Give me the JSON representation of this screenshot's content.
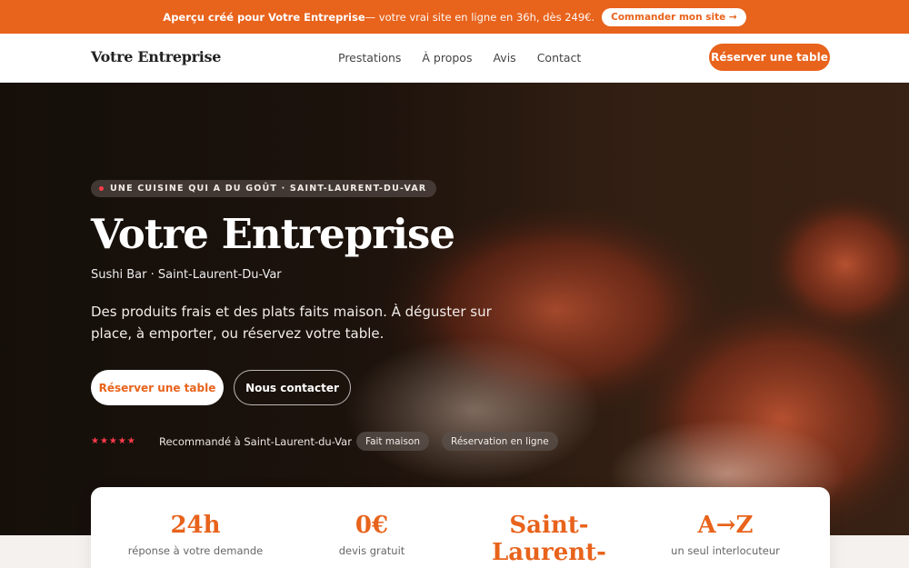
{
  "promo": {
    "bold": "Aperçu créé pour Votre Entreprise",
    "rest": " — votre vrai site en ligne en 36h, dès 249€.",
    "cta": "Commander mon site →"
  },
  "nav": {
    "brand": "Votre Entreprise",
    "links": [
      "Prestations",
      "À propos",
      "Avis",
      "Contact"
    ],
    "cta": "Réserver une table"
  },
  "hero": {
    "tag": "UNE CUISINE QUI A DU GOÛT · SAINT-LAURENT-DU-VAR",
    "title": "Votre Entreprise",
    "subtitle": "Sushi Bar · Saint-Laurent-Du-Var",
    "description": "Des produits frais et des plats faits maison. À déguster sur place, à emporter, ou réservez votre table.",
    "primary_button": "Réserver une table",
    "secondary_button": "Nous contacter",
    "stars": "★★★★★",
    "recommendation": "Recommandé à Saint-Laurent-du-Var",
    "pills": [
      "Fait maison",
      "Réservation en ligne"
    ]
  },
  "stats": [
    {
      "value": "24h",
      "label": "réponse à votre demande"
    },
    {
      "value": "0€",
      "label": "devis gratuit"
    },
    {
      "value": "Saint-Laurent-du-",
      "label": ""
    },
    {
      "value": "A→Z",
      "label": "un seul interlocuteur"
    }
  ],
  "colors": {
    "accent": "#e8631c",
    "star": "#ff3b4a"
  }
}
